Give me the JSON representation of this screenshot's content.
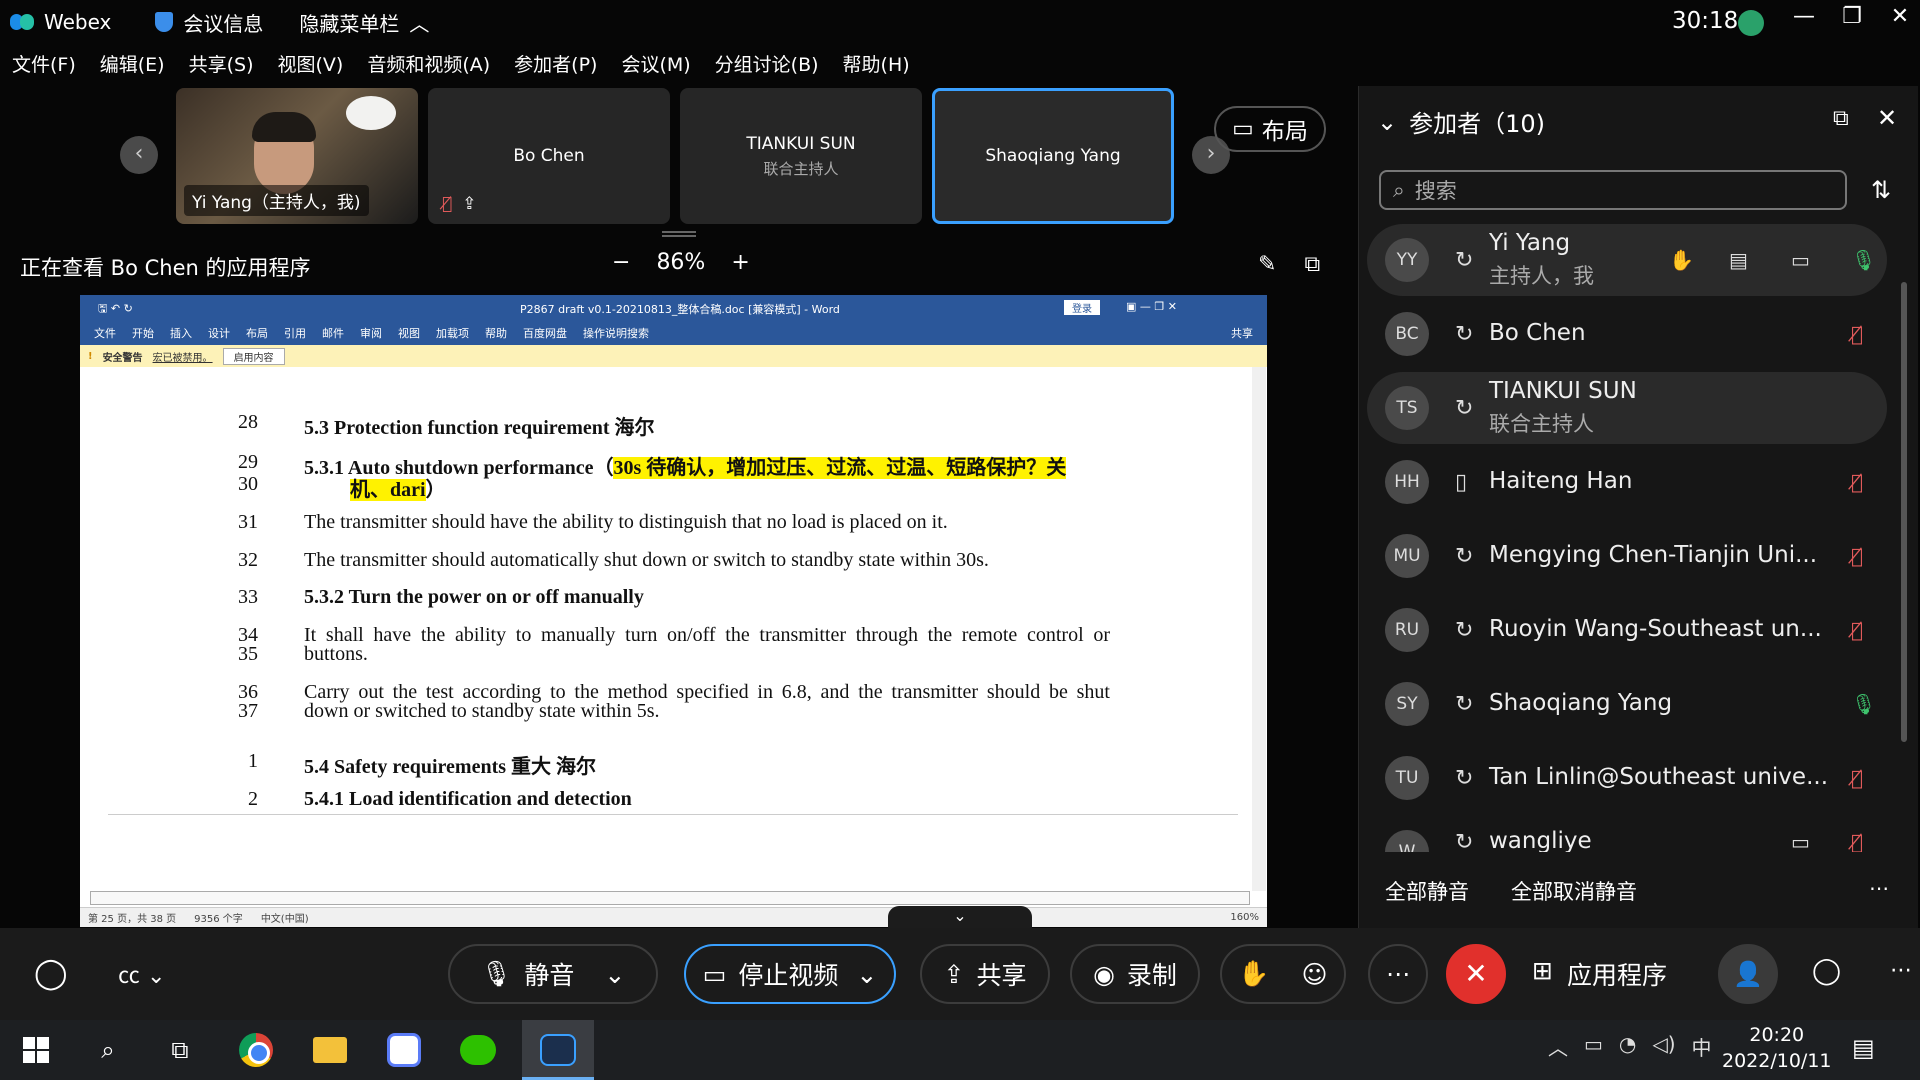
{
  "titlebar": {
    "app_name": "Webex",
    "meeting_info": "会议信息",
    "hide_menu": "隐藏菜单栏",
    "timer": "30:18"
  },
  "menubar": [
    "文件(F)",
    "编辑(E)",
    "共享(S)",
    "视图(V)",
    "音频和视频(A)",
    "参加者(P)",
    "会议(M)",
    "分组讨论(B)",
    "帮助(H)"
  ],
  "video_strip": {
    "tiles": [
      {
        "name": "Yi Yang（主持人，我)",
        "sub": ""
      },
      {
        "name": "Bo Chen",
        "sub": ""
      },
      {
        "name": "TIANKUI SUN",
        "sub": "联合主持人"
      },
      {
        "name": "Shaoqiang Yang",
        "sub": ""
      }
    ],
    "layout_label": "布局"
  },
  "viewing": {
    "label": "正在查看 Bo Chen 的应用程序",
    "zoom": "86%",
    "zoom_out": "−",
    "zoom_in": "+"
  },
  "word": {
    "title": "P2867 draft v0.1-20210813_整体合稿.doc [兼容模式] - Word",
    "login": "登录",
    "ribbon": [
      "文件",
      "开始",
      "插入",
      "设计",
      "布局",
      "引用",
      "邮件",
      "审阅",
      "视图",
      "加载项",
      "帮助",
      "百度网盘",
      "操作说明搜索",
      "共享"
    ],
    "warning_title": "安全警告",
    "warning_text": "宏已被禁用。",
    "warning_button": "启用内容",
    "status": [
      "第 25 页，共 38 页",
      "9356 个字",
      "中文(中国)",
      "160%"
    ],
    "lines": [
      {
        "n": "28",
        "t": "5.3  Protection function requirement 海尔"
      },
      {
        "n": "29",
        "t": "5.3.1  Auto shutdown performance（",
        "h": "30s 待确认，增加过压、过流、过温、短路保护？关"
      },
      {
        "n": "30",
        "h": "机、dari",
        "t": "）"
      },
      {
        "n": "31",
        "t": "The transmitter should have the ability to distinguish that no load is placed on it."
      },
      {
        "n": "32",
        "t": "The transmitter should automatically shut down or switch to standby state within 30s."
      },
      {
        "n": "33",
        "t": "5.3.2  Turn the power on or off manually"
      },
      {
        "n": "34",
        "t": "It shall have the ability to manually turn on/off the transmitter through the remote control or"
      },
      {
        "n": "35",
        "t": "buttons."
      },
      {
        "n": "36",
        "t": "Carry out the test according to the method specified in 6.8, and the transmitter should be shut"
      },
      {
        "n": "37",
        "t": "down or switched to standby state within 5s."
      },
      {
        "n": "1",
        "t": "5.4  Safety requirements 重大 海尔"
      },
      {
        "n": "2",
        "t": "5.4.1  Load identification and detection"
      }
    ]
  },
  "panel": {
    "title": "参加者（10)",
    "search_placeholder": "搜索",
    "participants": [
      {
        "initials": "YY",
        "name": "Yi Yang",
        "role": "主持人，我"
      },
      {
        "initials": "BC",
        "name": "Bo Chen",
        "role": ""
      },
      {
        "initials": "TS",
        "name": "TIANKUI SUN",
        "role": "联合主持人"
      },
      {
        "initials": "HH",
        "name": "Haiteng Han",
        "role": ""
      },
      {
        "initials": "MU",
        "name": "Mengying Chen-Tianjin Uni...",
        "role": ""
      },
      {
        "initials": "RU",
        "name": "Ruoyin Wang-Southeast un...",
        "role": ""
      },
      {
        "initials": "SY",
        "name": "Shaoqiang Yang",
        "role": ""
      },
      {
        "initials": "TU",
        "name": "Tan Linlin@Southeast unive...",
        "role": ""
      },
      {
        "initials": "W",
        "name": "wangliye",
        "role": ""
      }
    ],
    "mute_all": "全部静音",
    "unmute_all": "全部取消静音"
  },
  "toolbar": {
    "mute": "静音",
    "stop_video": "停止视频",
    "share": "共享",
    "record": "录制",
    "apps": "应用程序"
  },
  "taskbar": {
    "time": "20:20",
    "date": "2022/10/11",
    "ime": "中"
  },
  "colors": {
    "accent": "#3aa0ff",
    "leave": "#e1302c",
    "mic_on": "#3ec46d",
    "mic_muted": "#e05a5a",
    "highlight": "#fff200",
    "word_blue": "#2b579a"
  }
}
